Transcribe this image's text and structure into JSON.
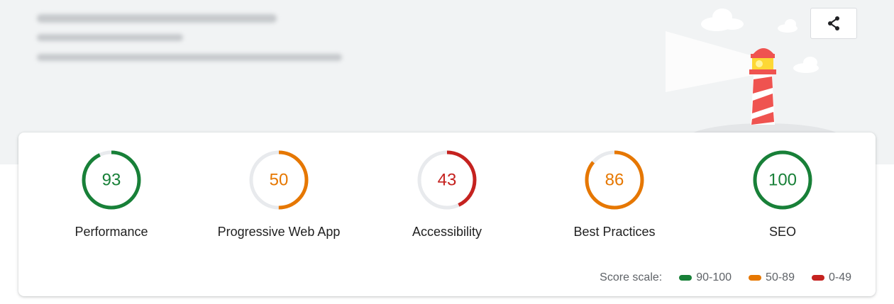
{
  "colors": {
    "pass": "#188038",
    "average": "#e67700",
    "fail": "#c5221f",
    "track": "#e8eaed"
  },
  "header": {
    "share_icon": "share-icon"
  },
  "scores": [
    {
      "label": "Performance",
      "value": 93,
      "rating": "pass"
    },
    {
      "label": "Progressive Web App",
      "value": 50,
      "rating": "average"
    },
    {
      "label": "Accessibility",
      "value": 43,
      "rating": "fail"
    },
    {
      "label": "Best Practices",
      "value": 86,
      "rating": "average"
    },
    {
      "label": "SEO",
      "value": 100,
      "rating": "pass"
    }
  ],
  "score_scale": {
    "label": "Score scale:",
    "ranges": [
      {
        "text": "90-100",
        "rating": "pass"
      },
      {
        "text": "50-89",
        "rating": "average"
      },
      {
        "text": "0-49",
        "rating": "fail"
      }
    ]
  }
}
